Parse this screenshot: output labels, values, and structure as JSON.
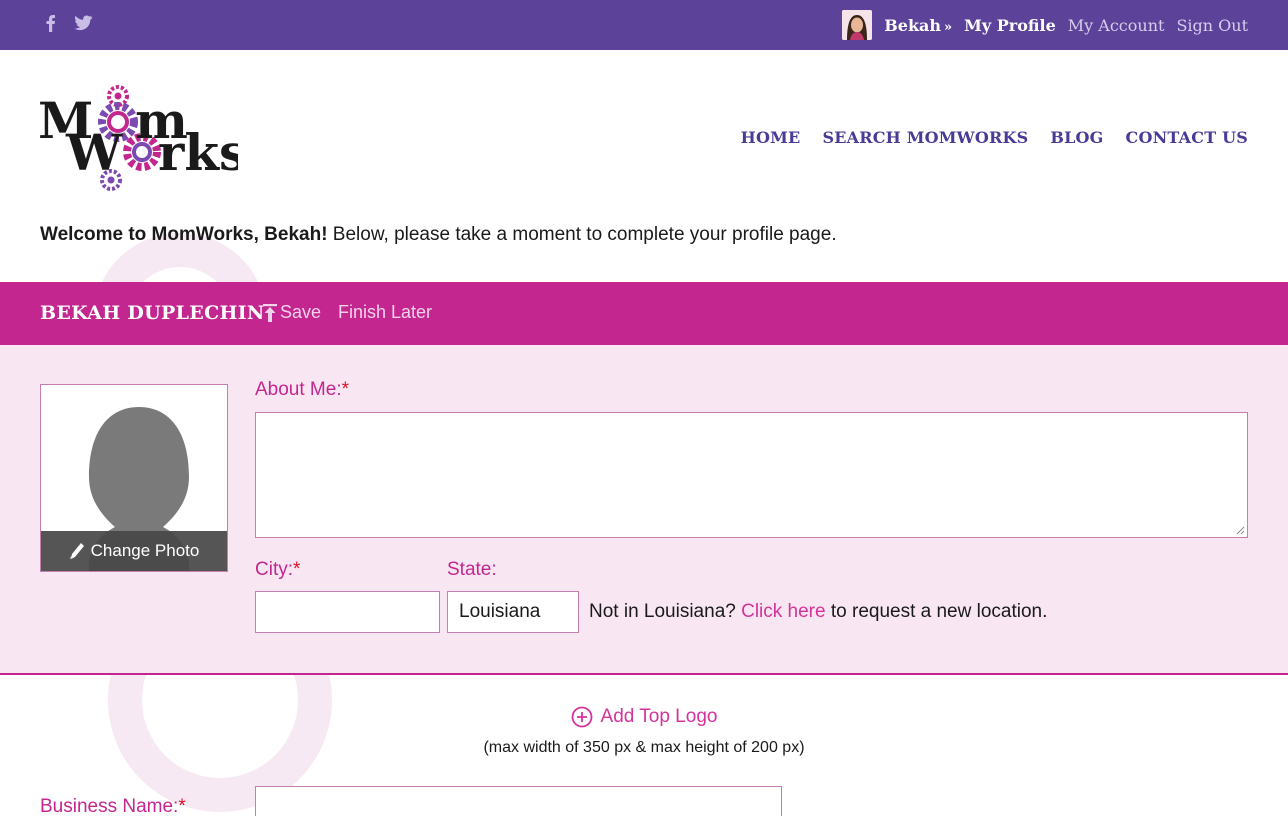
{
  "topbar": {
    "social": [
      "facebook-icon",
      "twitter-icon"
    ],
    "user_name": "Bekah",
    "user_arrow": "»",
    "links": [
      "My Profile",
      "My Account",
      "Sign Out"
    ]
  },
  "header": {
    "logo_alt": "MomWorks",
    "nav": [
      "HOME",
      "SEARCH MOMWORKS",
      "BLOG",
      "CONTACT US"
    ]
  },
  "welcome": {
    "bold": "Welcome to MomWorks, Bekah!",
    "rest": " Below, please take a moment to complete your profile page."
  },
  "profile_bar": {
    "name": "BEKAH DUPLECHIN",
    "save_label": "Save",
    "finish_label": "Finish Later"
  },
  "form": {
    "change_photo": "Change Photo",
    "about_label": "About Me:",
    "city_label": "City:",
    "state_label": "State:",
    "required_mark": "*",
    "city_value": "",
    "state_value": "Louisiana",
    "location_prefix": "Not in Louisiana? ",
    "location_link": "Click here",
    "location_suffix": " to request a new location."
  },
  "logo_section": {
    "add_label": "Add Top Logo",
    "hint": "(max width of 350 px & max height of 200 px)"
  },
  "business": {
    "label": "Business Name:",
    "required_mark": "*",
    "value": ""
  },
  "colors": {
    "topbar": "#5c4399",
    "accent": "#c42690",
    "panel": "#f8e6f2",
    "nav": "#4b3a96"
  }
}
